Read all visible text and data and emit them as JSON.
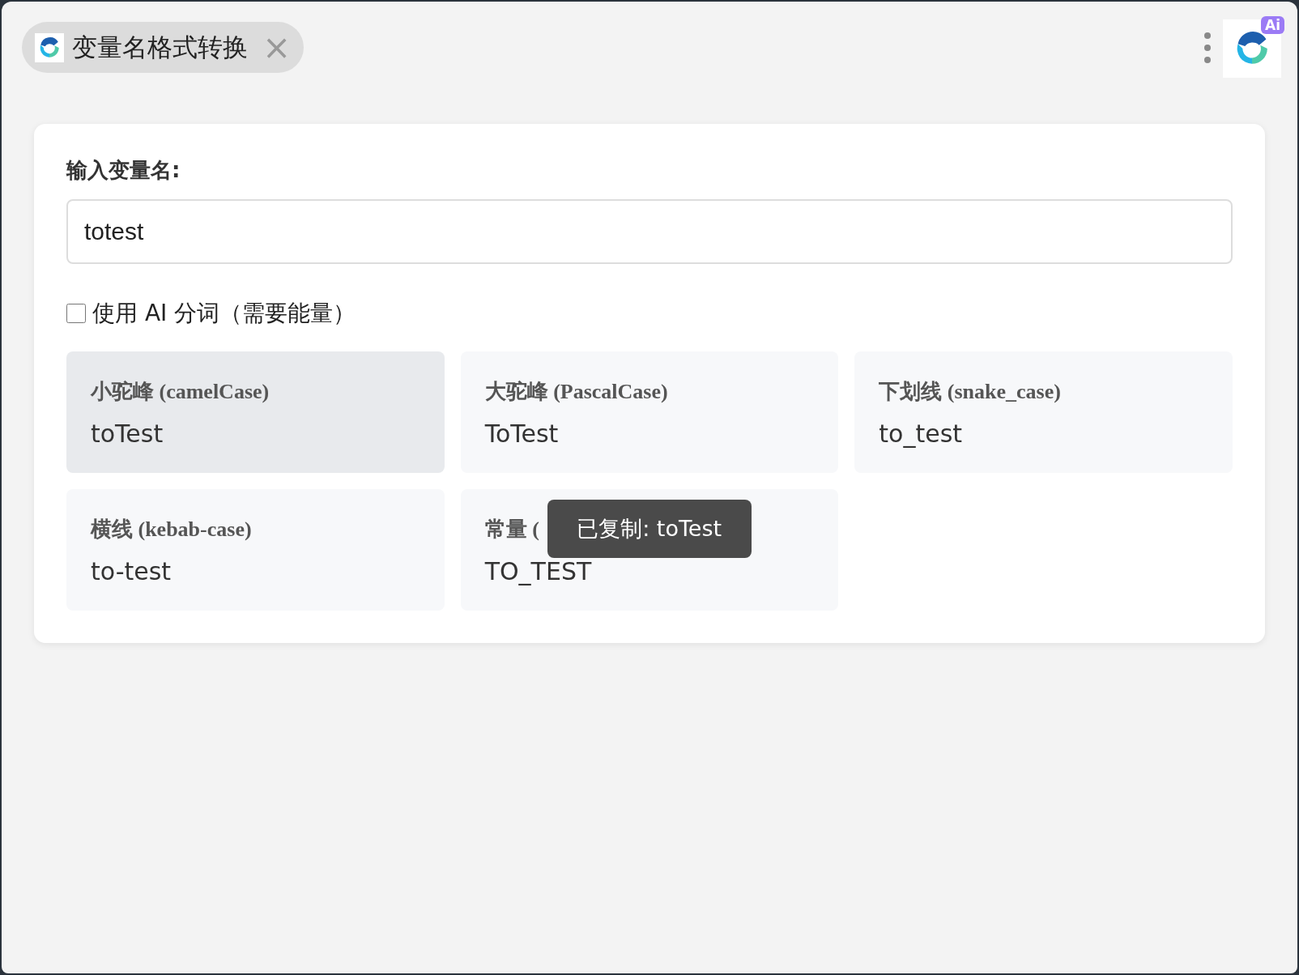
{
  "tab": {
    "title": "变量名格式转换",
    "close": "×"
  },
  "input": {
    "label": "输入变量名:",
    "value": "totest"
  },
  "ai_option": {
    "label": "使用 AI 分词（需要能量）",
    "checked": false
  },
  "results": [
    {
      "title": "小驼峰 (camelCase)",
      "value": "toTest",
      "highlighted": true
    },
    {
      "title": "大驼峰 (PascalCase)",
      "value": "ToTest",
      "highlighted": false
    },
    {
      "title": "下划线 (snake_case)",
      "value": "to_test",
      "highlighted": false
    },
    {
      "title": "横线 (kebab-case)",
      "value": "to-test",
      "highlighted": false
    },
    {
      "title": "常量 (",
      "value": "TO_TEST",
      "highlighted": false,
      "toast": "已复制: toTest"
    }
  ],
  "ai_badge": "Ai"
}
